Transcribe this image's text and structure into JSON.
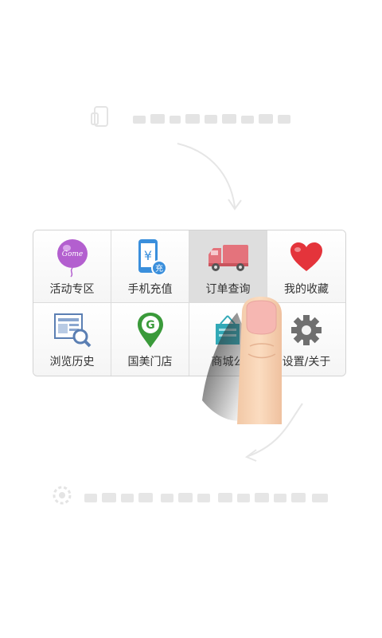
{
  "hints": {
    "top": "",
    "bottom": ""
  },
  "menu": {
    "items": [
      {
        "label": "活动专区",
        "icon": "balloon-icon"
      },
      {
        "label": "手机充值",
        "icon": "phone-recharge-icon"
      },
      {
        "label": "订单查询",
        "icon": "delivery-truck-icon"
      },
      {
        "label": "我的收藏",
        "icon": "heart-icon"
      },
      {
        "label": "浏览历史",
        "icon": "browse-history-icon"
      },
      {
        "label": "国美门店",
        "icon": "store-location-icon"
      },
      {
        "label": "商城公",
        "icon": "mall-announcement-icon"
      },
      {
        "label": "设置/关于",
        "icon": "gear-icon"
      }
    ],
    "balloon_text": "Gome"
  },
  "colors": {
    "balloon": "#b35fcf",
    "phone": "#3a8fdc",
    "truck": "#e4737c",
    "heart": "#e4343b",
    "history": "#5b7fb3",
    "store": "#3a9a3a",
    "announce": "#32a9b7",
    "gear": "#6f6f6f"
  }
}
